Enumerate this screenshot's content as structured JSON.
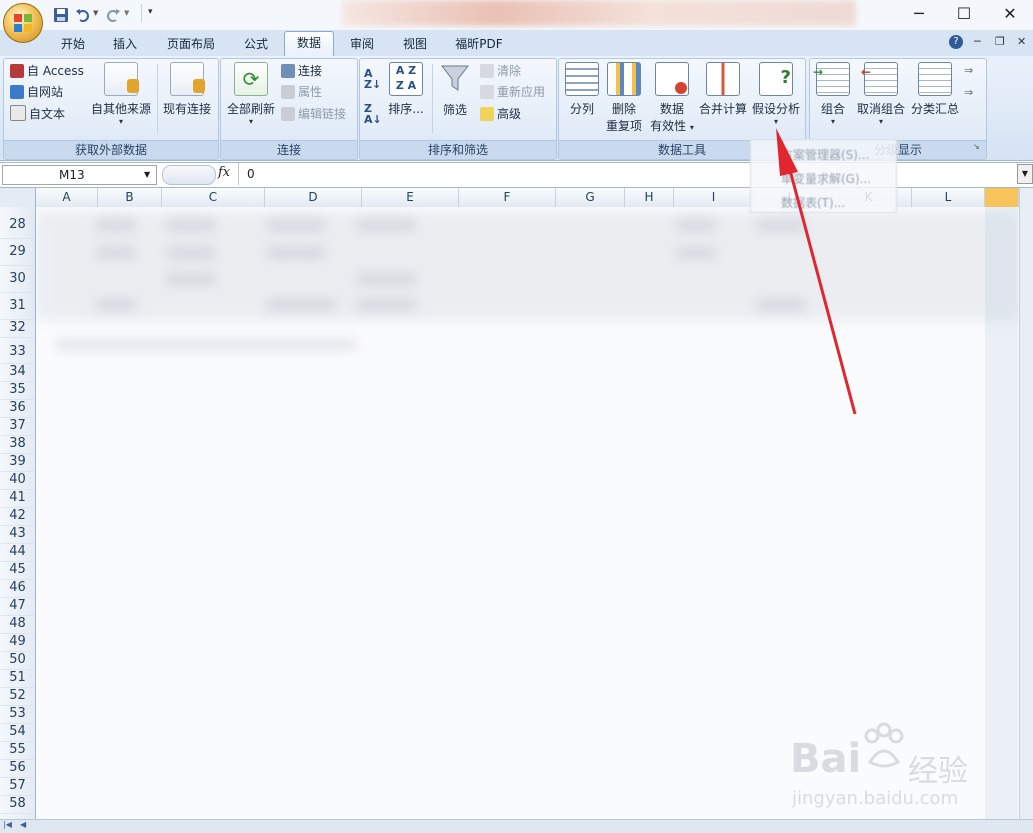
{
  "tabs": [
    "开始",
    "插入",
    "页面布局",
    "公式",
    "数据",
    "审阅",
    "视图",
    "福昕PDF"
  ],
  "active_tab": "数据",
  "ribbon": {
    "external": {
      "label": "获取外部数据",
      "access": "自 Access",
      "web": "自网站",
      "text": "自文本",
      "other": "自其他来源",
      "existing": "现有连接"
    },
    "connections": {
      "label": "连接",
      "refresh_all": "全部刷新",
      "connections": "连接",
      "properties": "属性",
      "edit_links": "编辑链接"
    },
    "sort_filter": {
      "label": "排序和筛选",
      "sort": "排序...",
      "filter": "筛选",
      "clear": "清除",
      "reapply": "重新应用",
      "advanced": "高级"
    },
    "data_tools": {
      "label": "数据工具",
      "text_to_columns": "分列",
      "remove_duplicates_1": "删除",
      "remove_duplicates_2": "重复项",
      "validation_1": "数据",
      "validation_2": "有效性",
      "consolidate": "合并计算",
      "what_if": "假设分析"
    },
    "outline": {
      "label": "分级显示",
      "group": "组合",
      "ungroup": "取消组合",
      "subtotal": "分类汇总"
    }
  },
  "dropdown_items": [
    "方案管理器(S)...",
    "单变量求解(G)...",
    "数据表(T)..."
  ],
  "formula_bar": {
    "name_box": "M13",
    "fx": "fx",
    "value": "0"
  },
  "columns": [
    "A",
    "B",
    "C",
    "D",
    "E",
    "F",
    "G",
    "H",
    "I",
    "J",
    "K",
    "L"
  ],
  "rows": [
    "28",
    "29",
    "30",
    "31",
    "32",
    "33",
    "34",
    "35",
    "36",
    "37",
    "38",
    "39",
    "40",
    "41",
    "42",
    "43",
    "44",
    "45",
    "46",
    "47",
    "48",
    "49",
    "50",
    "51",
    "52",
    "53",
    "54",
    "55",
    "56",
    "57",
    "58"
  ],
  "watermark": {
    "brand": "Bai",
    "brand2": "经验",
    "url": "jingyan.baidu.com"
  },
  "colors": {
    "ribbon_bg": "#dbe7f5",
    "selected_column": "#f7c45a",
    "arrow": "#e0262f"
  }
}
